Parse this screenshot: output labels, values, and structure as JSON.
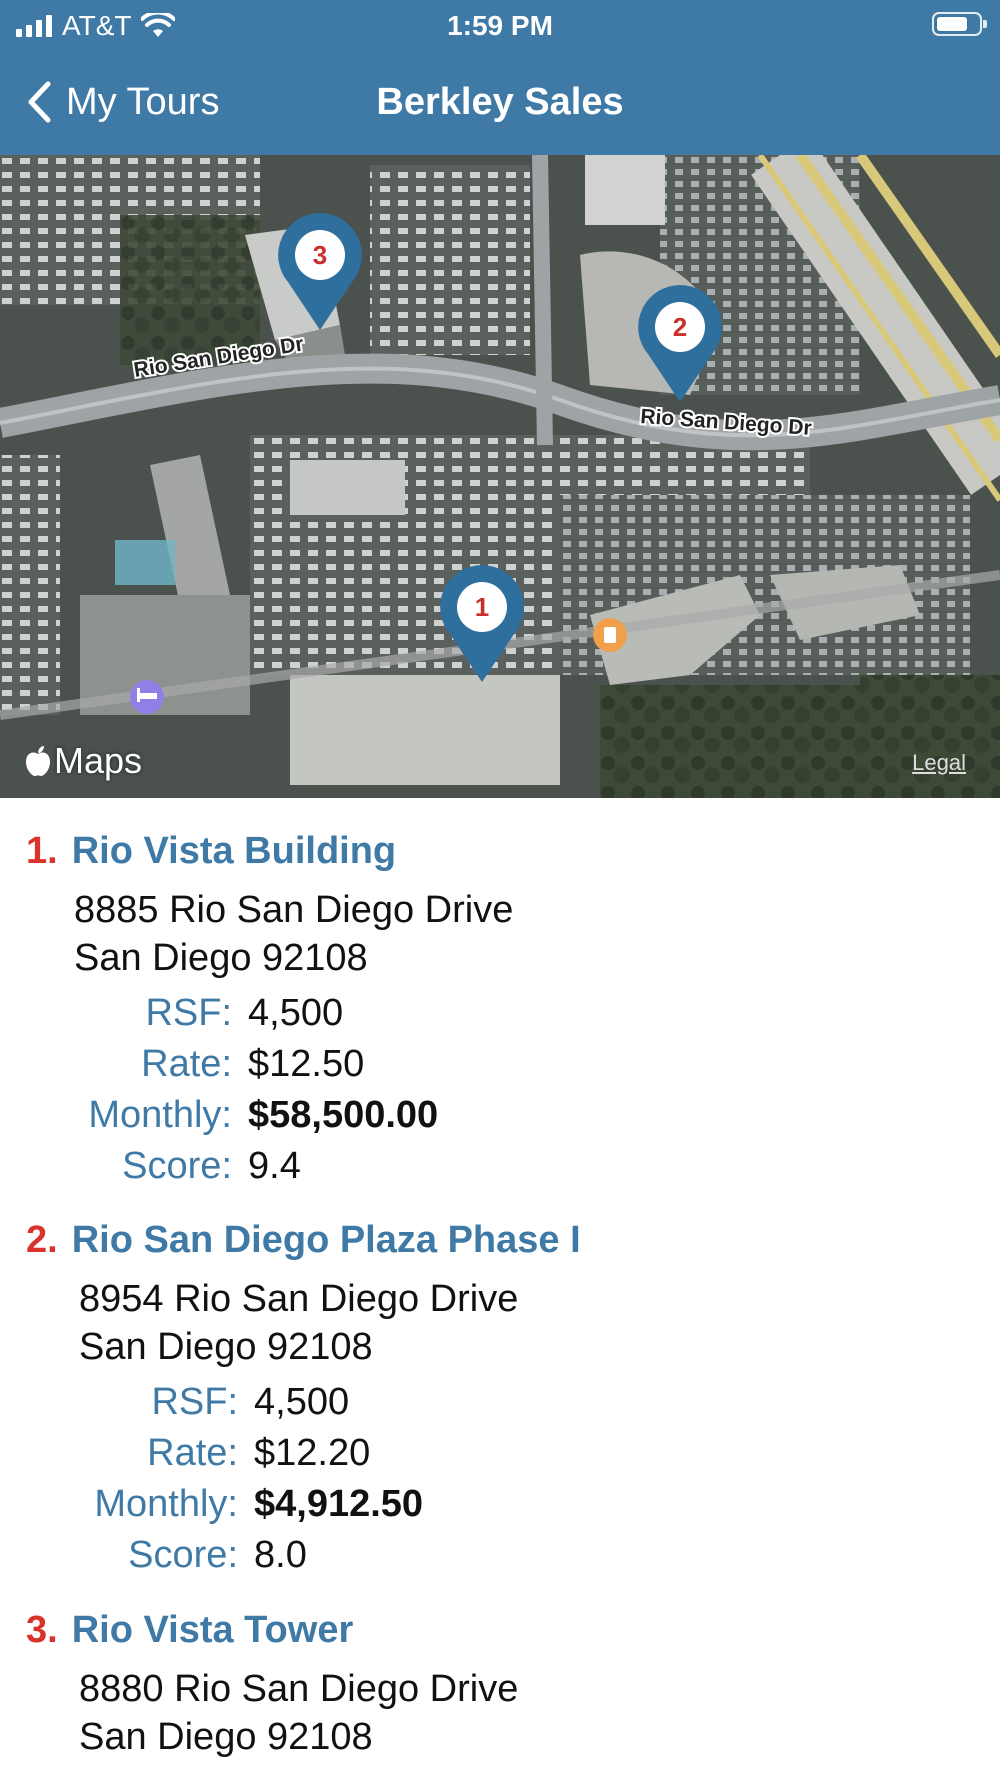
{
  "status_bar": {
    "carrier": "AT&T",
    "time": "1:59 PM"
  },
  "nav": {
    "back_label": "My Tours",
    "title": "Berkley Sales"
  },
  "map": {
    "roads": [
      "Rio San Diego Dr",
      "Rio San Diego Dr"
    ],
    "pins": [
      "1",
      "2",
      "3"
    ],
    "logo": "Maps",
    "legal": "Legal"
  },
  "listings": [
    {
      "number": "1.",
      "name": "Rio Vista Building",
      "address_line1": "8885 Rio San Diego Drive",
      "address_line2": "San Diego 92108",
      "rsf_label": "RSF:",
      "rsf": "4,500",
      "rate_label": "Rate:",
      "rate": "$12.50",
      "monthly_label": "Monthly:",
      "monthly": "$58,500.00",
      "score_label": "Score:",
      "score": "9.4"
    },
    {
      "number": "2.",
      "name": "Rio San Diego Plaza Phase I",
      "address_line1": "8954 Rio San Diego Drive",
      "address_line2": "San Diego 92108",
      "rsf_label": "RSF:",
      "rsf": "4,500",
      "rate_label": "Rate:",
      "rate": "$12.20",
      "monthly_label": "Monthly:",
      "monthly": "$4,912.50",
      "score_label": "Score:",
      "score": "8.0"
    },
    {
      "number": "3.",
      "name": "Rio Vista Tower",
      "address_line1": "8880 Rio San Diego Drive",
      "address_line2": "San Diego 92108"
    }
  ],
  "colors": {
    "header": "#3f7aa6",
    "accent_number": "#d9342b",
    "label_blue": "#3f7aa6"
  }
}
